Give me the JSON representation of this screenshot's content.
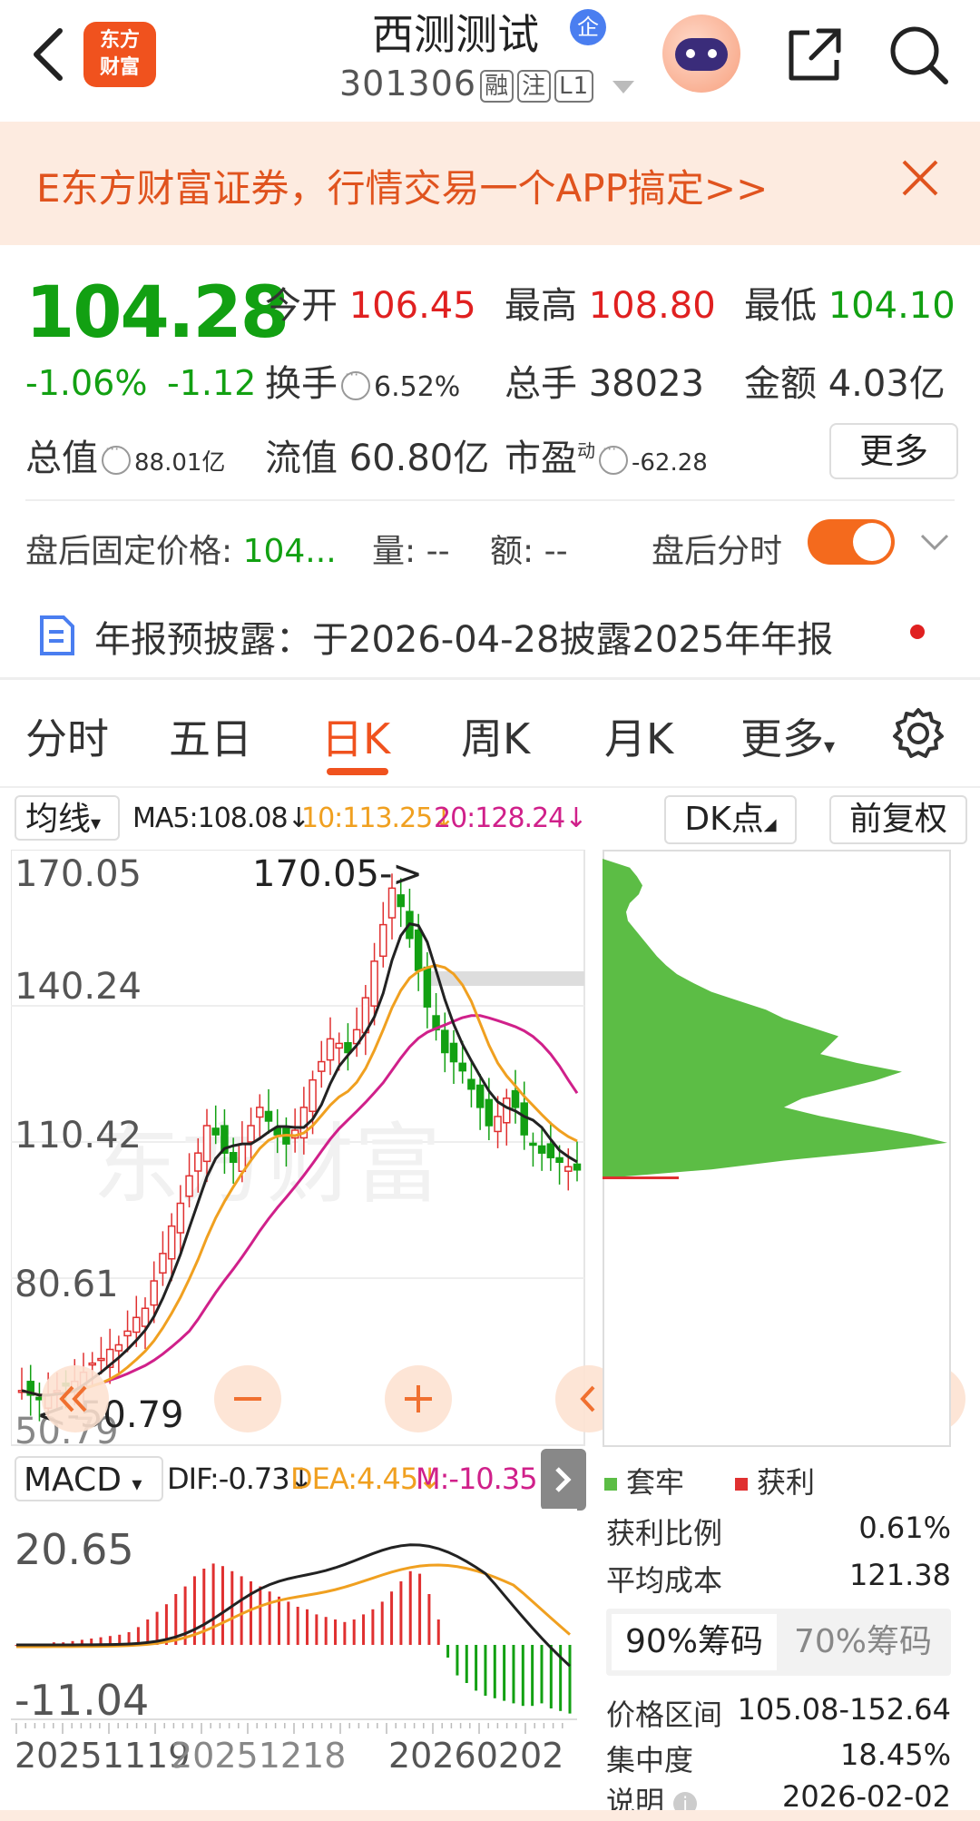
{
  "header": {
    "title": "西测测试",
    "qi_badge": "企",
    "code": "301306",
    "tag_rong": "融",
    "tag_zhu": "注",
    "tag_level": "L1",
    "logo_line1": "东方",
    "logo_line2": "财富"
  },
  "banner": {
    "text": "E东方财富证券，行情交易一个APP搞定>>"
  },
  "quote": {
    "price": "104.28",
    "change_pct": "-1.06%",
    "change_amt": "-1.12",
    "open_label": "今开",
    "open": "106.45",
    "high_label": "最高",
    "high": "108.80",
    "low_label": "最低",
    "low": "104.10",
    "turnover_label": "换手",
    "turnover": "6.52%",
    "volume_label": "总手",
    "volume": "38023",
    "amount_label": "金额",
    "amount": "4.03亿",
    "mktcap_label": "总值",
    "mktcap": "88.01亿",
    "float_label": "流值",
    "float": "60.80亿",
    "pe_label": "市盈",
    "pe_sup": "动",
    "pe": "-62.28",
    "more_label": "更多"
  },
  "after_hours": {
    "price_label": "盘后固定价格:",
    "price": "104...",
    "vol_label": "量:",
    "vol": "--",
    "amt_label": "额:",
    "amt": "--",
    "timeshare_label": "盘后分时",
    "toggle_on": true
  },
  "notice": {
    "text": "年报预披露：于2026-04-28披露2025年年报"
  },
  "tabs": [
    {
      "label": "分时"
    },
    {
      "label": "五日"
    },
    {
      "label": "日K"
    },
    {
      "label": "周K"
    },
    {
      "label": "月K"
    },
    {
      "label": "更多"
    }
  ],
  "indicators": {
    "ma_select": "均线",
    "ma5": "MA5:108.08↓",
    "ma10": "10:113.25↓",
    "ma20": "20:128.24↓",
    "dk_label": "DK点",
    "adjust_label": "前复权",
    "colors": {
      "ma5": "#222222",
      "ma10": "#f0a020",
      "ma20": "#d0208a"
    }
  },
  "kline": {
    "y_labels": [
      "170.05",
      "140.24",
      "110.42",
      "80.61",
      "50.79"
    ],
    "max_annotation": "170.05->",
    "min_annotation": "<-50.79",
    "watermark": "东方财富"
  },
  "macd": {
    "select": "MACD",
    "dif": "DIF:-0.73↓",
    "dea": "DEA:4.45↓",
    "m": "M:-10.35↑",
    "y_top": "20.65",
    "y_bottom": "-11.04",
    "dates": [
      "20251119",
      "20251218",
      "20260202"
    ]
  },
  "chips": {
    "legend_trapped": "套牢",
    "legend_profit": "获利",
    "profit_ratio_label": "获利比例",
    "profit_ratio": "0.61%",
    "avg_cost_label": "平均成本",
    "avg_cost": "121.38",
    "tab_90": "90%筹码",
    "tab_70": "70%筹码",
    "range_label": "价格区间",
    "range": "105.08-152.64",
    "concentration_label": "集中度",
    "concentration": "18.45%",
    "note_label": "说明",
    "note_date": "2026-02-02"
  }
}
